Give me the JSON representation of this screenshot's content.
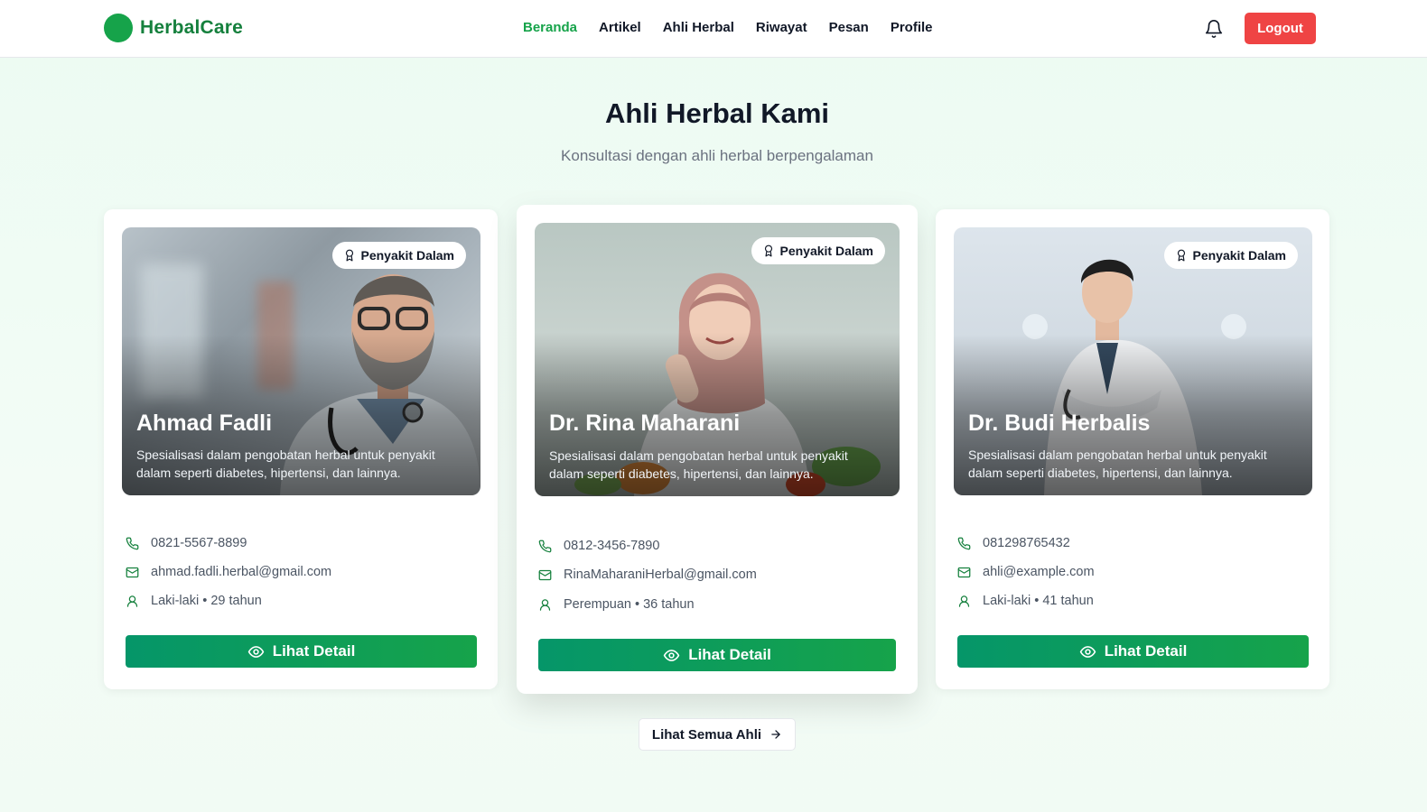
{
  "brand": {
    "name": "HerbalCare",
    "color": "#16a34a"
  },
  "nav": {
    "links": [
      "Beranda",
      "Artikel",
      "Ahli Herbal",
      "Riwayat",
      "Pesan",
      "Profile"
    ],
    "active": "Beranda",
    "logout_label": "Logout"
  },
  "section": {
    "title": "Ahli Herbal Kami",
    "subtitle": "Konsultasi dengan ahli herbal berpengalaman"
  },
  "experts": [
    {
      "name": "Ahmad Fadli",
      "specialty": "Penyakit Dalam",
      "description": "Spesialisasi dalam pengobatan herbal untuk penyakit dalam seperti diabetes, hipertensi, dan lainnya.",
      "phone": "0821-5567-8899",
      "email": "ahmad.fadli.herbal@gmail.com",
      "gender_age": "Laki-laki • 29 tahun",
      "button_label": "Lihat Detail",
      "photo": "bearded-male-doctor-with-glasses-and-stethoscope"
    },
    {
      "name": "Dr. Rina Maharani",
      "specialty": "Penyakit Dalam",
      "description": "Spesialisasi dalam pengobatan herbal untuk penyakit dalam seperti diabetes, hipertensi, dan lainnya.",
      "phone": "0812-3456-7890",
      "email": "RinaMaharaniHerbal@gmail.com",
      "gender_age": "Perempuan • 36 tahun",
      "button_label": "Lihat Detail",
      "photo": "female-doctor-in-pink-hijab-with-vegetables"
    },
    {
      "name": "Dr. Budi Herbalis",
      "specialty": "Penyakit Dalam",
      "description": "Spesialisasi dalam pengobatan herbal untuk penyakit dalam seperti diabetes, hipertensi, dan lainnya.",
      "phone": "081298765432",
      "email": "ahli@example.com",
      "gender_age": "Laki-laki • 41 tahun",
      "button_label": "Lihat Detail",
      "photo": "young-male-doctor-arms-crossed"
    }
  ],
  "view_all_label": "Lihat Semua Ahli",
  "icons": {
    "badge": "award-icon",
    "phone": "phone-icon",
    "email": "mail-icon",
    "person": "user-icon",
    "detail": "eye-icon",
    "view_all": "arrow-right-icon",
    "notification": "bell-icon"
  },
  "colors": {
    "accent": "#16a34a",
    "button_gradient_start": "#059669",
    "button_gradient_end": "#16a34a",
    "logout": "#ef4444",
    "info_icon": "#15803d"
  }
}
